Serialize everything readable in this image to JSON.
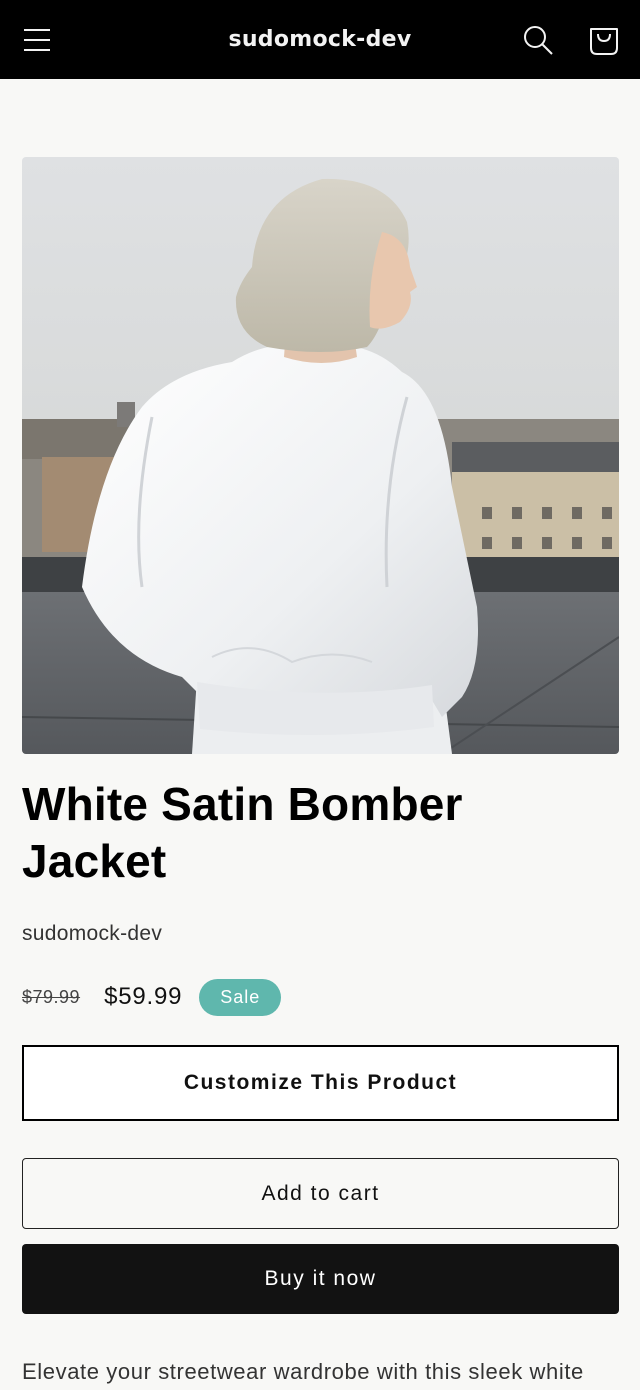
{
  "header": {
    "store_name": "sudomock-dev",
    "icons": [
      "hamburger-menu-icon",
      "search-icon",
      "cart-icon"
    ]
  },
  "product": {
    "image_alt": "White Satin Bomber Jacket",
    "title": "White Satin Bomber Jacket",
    "vendor": "sudomock-dev",
    "price_regular": "$79.99",
    "price_sale": "$59.99",
    "badge": "Sale",
    "description": "Elevate your streetwear wardrobe with this sleek white"
  },
  "buttons": {
    "customize": "Customize This Product",
    "add_to_cart": "Add to cart",
    "buy_now": "Buy it now"
  },
  "colors": {
    "header_bg": "#000000",
    "page_bg": "#f8f8f6",
    "sale_badge": "#5fb7ad",
    "buy_button": "#121212"
  }
}
